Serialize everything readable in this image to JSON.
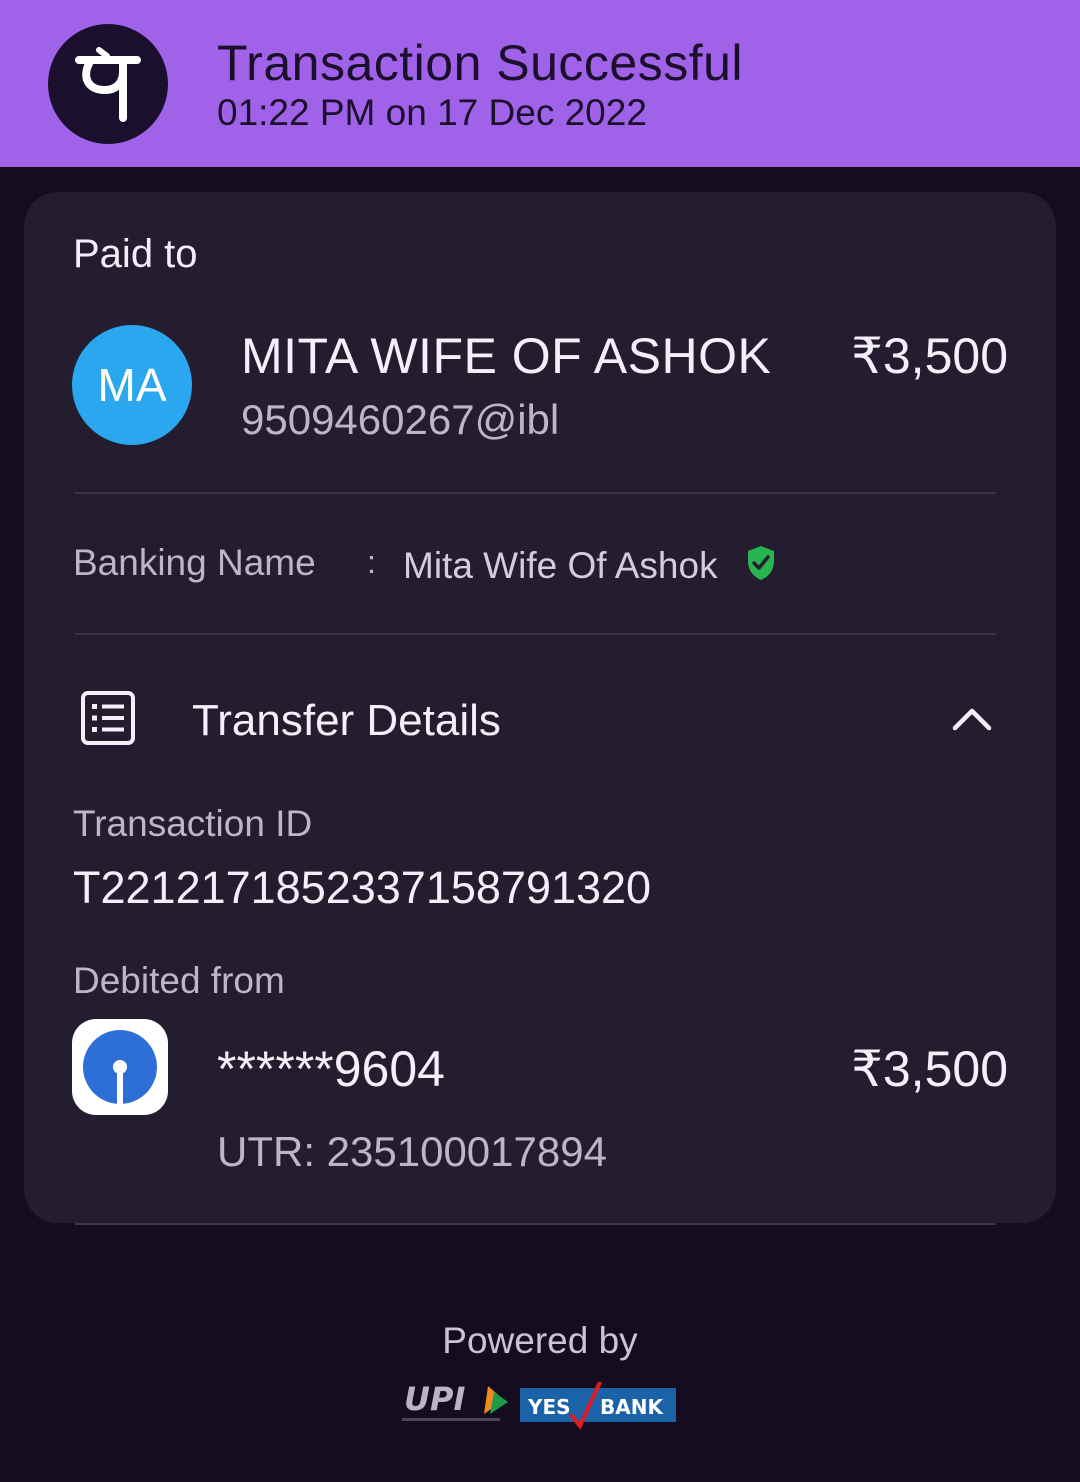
{
  "header": {
    "title": "Transaction Successful",
    "datetime": "01:22 PM on 17 Dec 2022",
    "logo_glyph": "पे",
    "bg_color": "#a162ea"
  },
  "payee": {
    "section_label": "Paid to",
    "initials": "MA",
    "name": "MITA WIFE OF ASHOK",
    "upi_id": "9509460267@ibl",
    "amount": "₹3,500",
    "avatar_color": "#2aa7ee"
  },
  "banking": {
    "label": "Banking Name",
    "separator": ":",
    "value": "Mita Wife Of Ashok",
    "verified_icon": "verified-shield-icon"
  },
  "transfer_details": {
    "title": "Transfer Details",
    "expanded": true,
    "transaction_id_label": "Transaction ID",
    "transaction_id": "T2212171852337158791320",
    "debited_label": "Debited from",
    "account": "******9604",
    "account_amount": "₹3,500",
    "utr": "UTR: 235100017894"
  },
  "footer": {
    "powered_by": "Powered by",
    "logos": [
      "UPI",
      "YES BANK"
    ]
  }
}
